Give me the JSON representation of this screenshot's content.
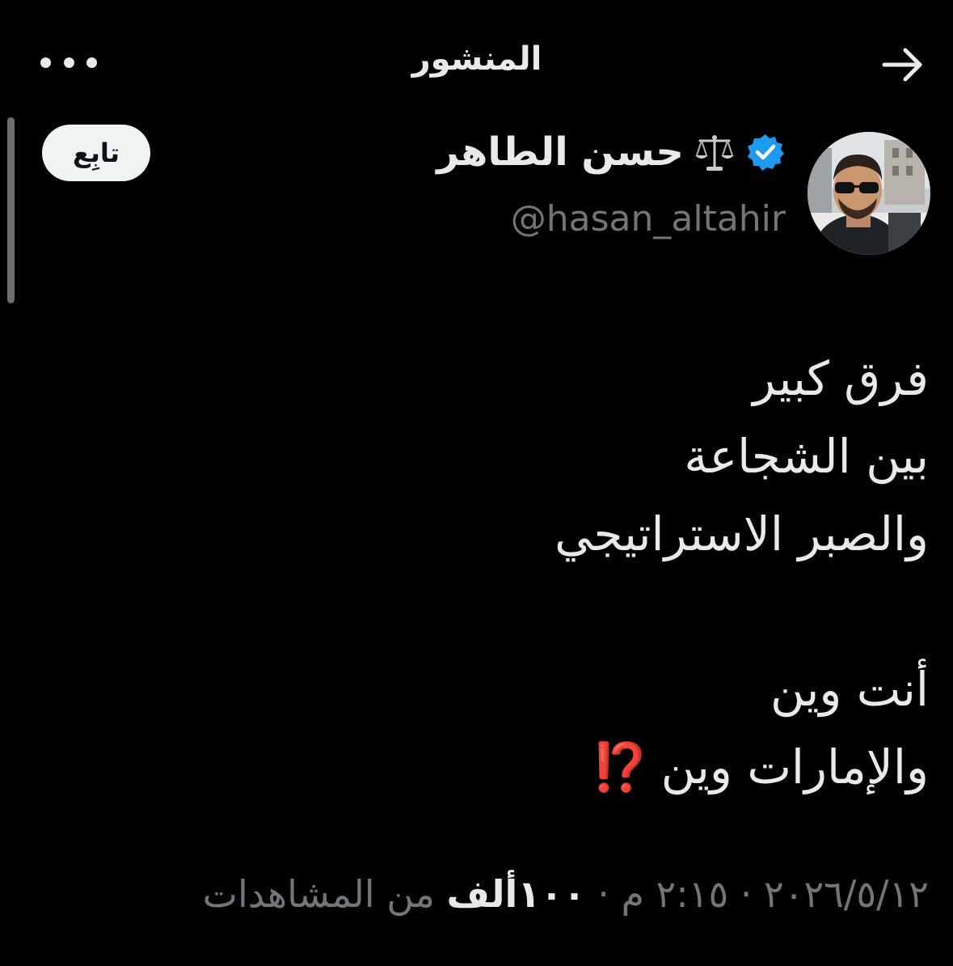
{
  "header": {
    "title": "المنشور",
    "back_icon": "arrow-right-icon",
    "more_icon": "more-horizontal-icon"
  },
  "author": {
    "display_name": "حسن الطاهر",
    "name_emoji": "⚖️",
    "handle": "@hasan_altahir",
    "verified_color": "#1d9bf0"
  },
  "follow_button": {
    "label": "تابِع"
  },
  "tweet": {
    "lines": [
      "فرق كبير",
      "بين الشجاعة",
      "والصبر الاستراتيجي",
      "",
      "أنت وين",
      "والإمارات وين"
    ],
    "end_emoji": "⁉️"
  },
  "meta": {
    "date": "٢٠٢٦/٥/١٢",
    "time": "٢:١٥ م",
    "separator": "·",
    "views_count": "١٠٠ألف",
    "views_label": "من المشاهدات"
  },
  "colors": {
    "background": "#000000",
    "primary_text": "#e7e9ea",
    "secondary_text": "#71767b",
    "verified": "#1d9bf0",
    "emoji_red": "#e0301e"
  }
}
